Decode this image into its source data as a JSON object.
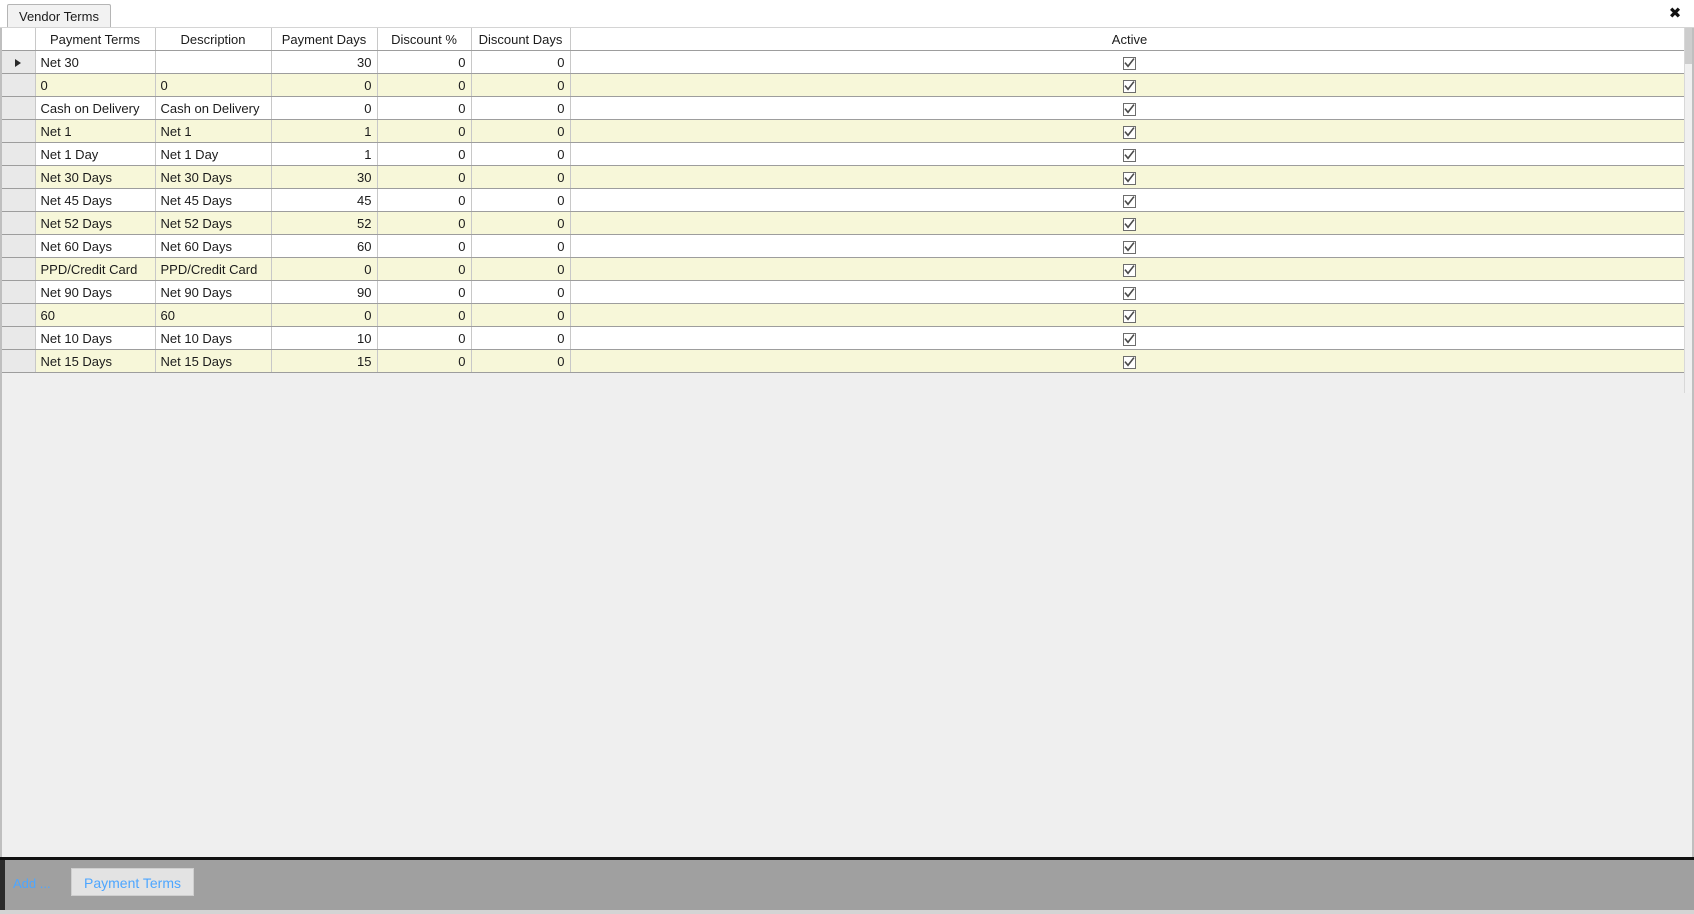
{
  "window": {
    "close_all_tabs_label": "✖"
  },
  "tabs": [
    {
      "label": "Vendor Terms",
      "active": true
    }
  ],
  "grid": {
    "columns": [
      {
        "key": "selector",
        "label": ""
      },
      {
        "key": "payment_terms",
        "label": "Payment Terms"
      },
      {
        "key": "description",
        "label": "Description"
      },
      {
        "key": "payment_days",
        "label": "Payment Days"
      },
      {
        "key": "discount_pct",
        "label": "Discount %"
      },
      {
        "key": "discount_days",
        "label": "Discount Days"
      },
      {
        "key": "active",
        "label": "Active"
      }
    ],
    "rows": [
      {
        "selected": true,
        "payment_terms": "Net 30",
        "description": "",
        "payment_days": "30",
        "discount_pct": "0",
        "discount_days": "0",
        "active": true
      },
      {
        "selected": false,
        "payment_terms": "0",
        "description": "0",
        "payment_days": "0",
        "discount_pct": "0",
        "discount_days": "0",
        "active": true
      },
      {
        "selected": false,
        "payment_terms": "Cash on Delivery",
        "description": "Cash on Delivery",
        "payment_days": "0",
        "discount_pct": "0",
        "discount_days": "0",
        "active": true
      },
      {
        "selected": false,
        "payment_terms": "Net 1",
        "description": "Net 1",
        "payment_days": "1",
        "discount_pct": "0",
        "discount_days": "0",
        "active": true
      },
      {
        "selected": false,
        "payment_terms": "Net 1 Day",
        "description": "Net 1 Day",
        "payment_days": "1",
        "discount_pct": "0",
        "discount_days": "0",
        "active": true
      },
      {
        "selected": false,
        "payment_terms": "Net 30 Days",
        "description": "Net 30 Days",
        "payment_days": "30",
        "discount_pct": "0",
        "discount_days": "0",
        "active": true
      },
      {
        "selected": false,
        "payment_terms": "Net 45 Days",
        "description": "Net 45 Days",
        "payment_days": "45",
        "discount_pct": "0",
        "discount_days": "0",
        "active": true
      },
      {
        "selected": false,
        "payment_terms": "Net 52 Days",
        "description": "Net 52 Days",
        "payment_days": "52",
        "discount_pct": "0",
        "discount_days": "0",
        "active": true
      },
      {
        "selected": false,
        "payment_terms": "Net 60 Days",
        "description": "Net 60 Days",
        "payment_days": "60",
        "discount_pct": "0",
        "discount_days": "0",
        "active": true
      },
      {
        "selected": false,
        "payment_terms": "PPD/Credit Card",
        "description": "PPD/Credit Card",
        "payment_days": "0",
        "discount_pct": "0",
        "discount_days": "0",
        "active": true
      },
      {
        "selected": false,
        "payment_terms": "Net 90 Days",
        "description": "Net 90 Days",
        "payment_days": "90",
        "discount_pct": "0",
        "discount_days": "0",
        "active": true
      },
      {
        "selected": false,
        "payment_terms": "60",
        "description": "60",
        "payment_days": "0",
        "discount_pct": "0",
        "discount_days": "0",
        "active": true
      },
      {
        "selected": false,
        "payment_terms": "Net 10 Days",
        "description": "Net 10 Days",
        "payment_days": "10",
        "discount_pct": "0",
        "discount_days": "0",
        "active": true
      },
      {
        "selected": false,
        "payment_terms": "Net 15 Days",
        "description": "Net 15 Days",
        "payment_days": "15",
        "discount_pct": "0",
        "discount_days": "0",
        "active": true
      }
    ]
  },
  "bottom_toolbar": {
    "add_label": "Add ...",
    "payment_terms_button": "Payment Terms"
  },
  "colors": {
    "alt_row": "#f7f7d9",
    "row": "#ffffff",
    "toolbar_bg": "#a0a0a0",
    "link_blue": "#4da6ff",
    "grid_line": "#9d9d9d",
    "page_bg": "#efefef"
  }
}
